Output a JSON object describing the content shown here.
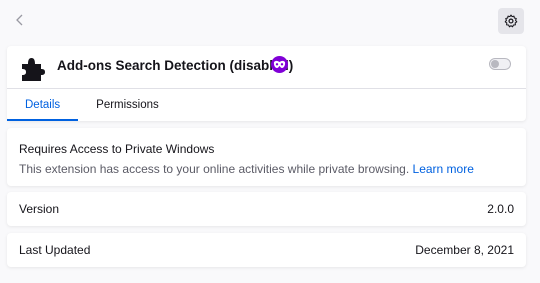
{
  "addon": {
    "name": "Add-ons Search Detection (disabled)",
    "enabled": false
  },
  "tabs": [
    {
      "label": "Details",
      "active": true
    },
    {
      "label": "Permissions",
      "active": false
    }
  ],
  "private_access": {
    "title": "Requires Access to Private Windows",
    "description": "This extension has access to your online activities while private browsing.",
    "link_label": "Learn more"
  },
  "details": {
    "version_label": "Version",
    "version_value": "2.0.0",
    "updated_label": "Last Updated",
    "updated_value": "December 8, 2021"
  },
  "colors": {
    "accent": "#0061e0",
    "private_badge": "#8000d7"
  },
  "icons": {
    "back": "chevron-left-icon",
    "settings": "gear-icon",
    "addon": "puzzle-piece-icon",
    "private": "private-browsing-mask-icon"
  }
}
